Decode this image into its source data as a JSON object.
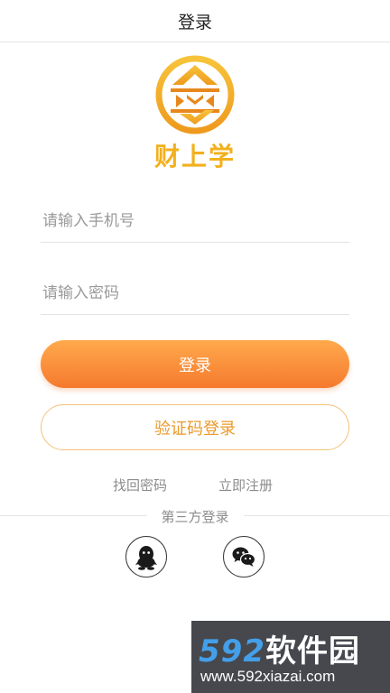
{
  "header": {
    "title": "登录"
  },
  "brand": {
    "name": "财上学",
    "color": "#f2b01e"
  },
  "form": {
    "phone_placeholder": "请输入手机号",
    "password_placeholder": "请输入密码",
    "login_label": "登录",
    "code_login_label": "验证码登录"
  },
  "links": {
    "forgot": "找回密码",
    "register": "立即注册"
  },
  "third_party": {
    "label": "第三方登录",
    "icons": [
      "qq-icon",
      "wechat-icon"
    ]
  },
  "watermark": {
    "brand_number": "592",
    "brand_text": "软件园",
    "url": "www.592xiazai.com"
  },
  "colors": {
    "accent_start": "#ffa94c",
    "accent_end": "#f57a2e",
    "outline": "#f3c27a"
  }
}
